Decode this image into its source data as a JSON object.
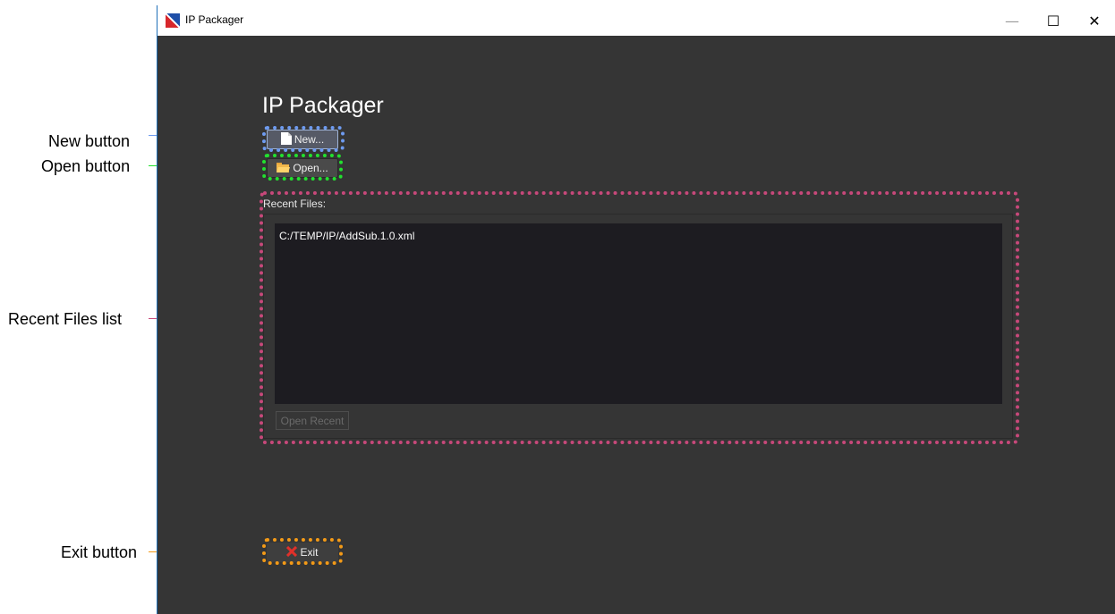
{
  "callouts": {
    "new": "New button",
    "open": "Open button",
    "recent": "Recent Files list",
    "exit": "Exit button"
  },
  "window": {
    "title": "IP Packager",
    "minimize_glyph": "—",
    "maximize_glyph": "☐",
    "close_glyph": "✕"
  },
  "app": {
    "heading": "IP Packager",
    "new_label": "New...",
    "open_label": "Open...",
    "recent_files_label": "Recent Files:",
    "recent_files": [
      "C:/TEMP/IP/AddSub.1.0.xml"
    ],
    "open_recent_label": "Open Recent",
    "exit_label": "Exit"
  },
  "icons": {
    "app": "ip-packager-app-icon",
    "new": "document-icon",
    "open": "folder-icon",
    "exit": "red-x-icon"
  },
  "colors": {
    "window_bg": "#353535",
    "list_bg": "#1d1c21",
    "callout_new": "#6e9bf0",
    "callout_open": "#22e02f",
    "callout_recent": "#c7487a",
    "callout_exit": "#f39a17"
  }
}
